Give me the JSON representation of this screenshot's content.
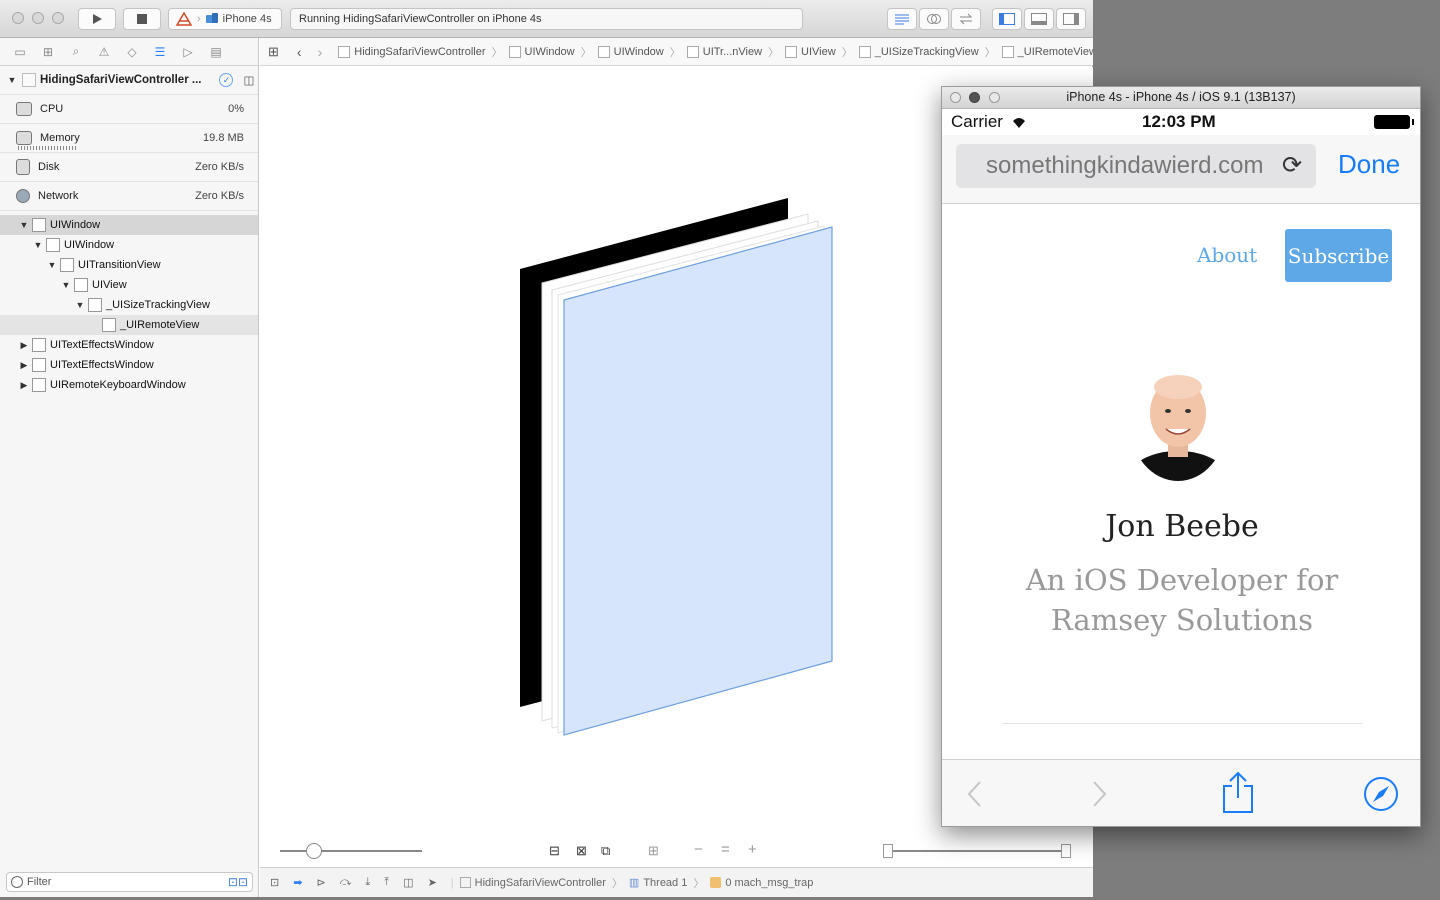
{
  "toolbar": {
    "scheme_device": "iPhone 4s",
    "activity_status": "Running HidingSafariViewController on iPhone 4s"
  },
  "sidebar": {
    "process_name": "HidingSafariViewController ...",
    "gauges": [
      {
        "label": "CPU",
        "value": "0%",
        "icon": "cpu-icon"
      },
      {
        "label": "Memory",
        "value": "19.8 MB",
        "icon": "memory-icon"
      },
      {
        "label": "Disk",
        "value": "Zero KB/s",
        "icon": "disk-icon"
      },
      {
        "label": "Network",
        "value": "Zero KB/s",
        "icon": "network-icon"
      }
    ],
    "tree": [
      {
        "label": "UIWindow"
      },
      {
        "label": "UIWindow"
      },
      {
        "label": "UITransitionView"
      },
      {
        "label": "UIView"
      },
      {
        "label": "_UISizeTrackingView"
      },
      {
        "label": "_UIRemoteView"
      },
      {
        "label": "UITextEffectsWindow"
      },
      {
        "label": "UITextEffectsWindow"
      },
      {
        "label": "UIRemoteKeyboardWindow"
      }
    ],
    "filter_placeholder": "Filter"
  },
  "jumpbar": {
    "crumbs": [
      "HidingSafariViewController",
      "UIWindow",
      "UIWindow",
      "UITr...nView",
      "UIView",
      "_UISizeTrackingView",
      "_UIRemoteView"
    ]
  },
  "debugbar": {
    "process": "HidingSafariViewController",
    "thread": "Thread 1",
    "frame": "0 mach_msg_trap"
  },
  "simulator": {
    "title": "iPhone 4s - iPhone 4s / iOS 9.1 (13B137)",
    "carrier": "Carrier",
    "time": "12:03 PM",
    "url": "somethingkindawierd.com",
    "done_label": "Done",
    "page": {
      "about_label": "About",
      "subscribe_label": "Subscribe",
      "name": "Jon Beebe",
      "tagline": "An iOS Developer for Ramsey Solutions"
    }
  },
  "colors": {
    "accent": "#2d7ff9",
    "site_blue": "#5fa8e8",
    "view_fill": "#d6e5fb"
  }
}
